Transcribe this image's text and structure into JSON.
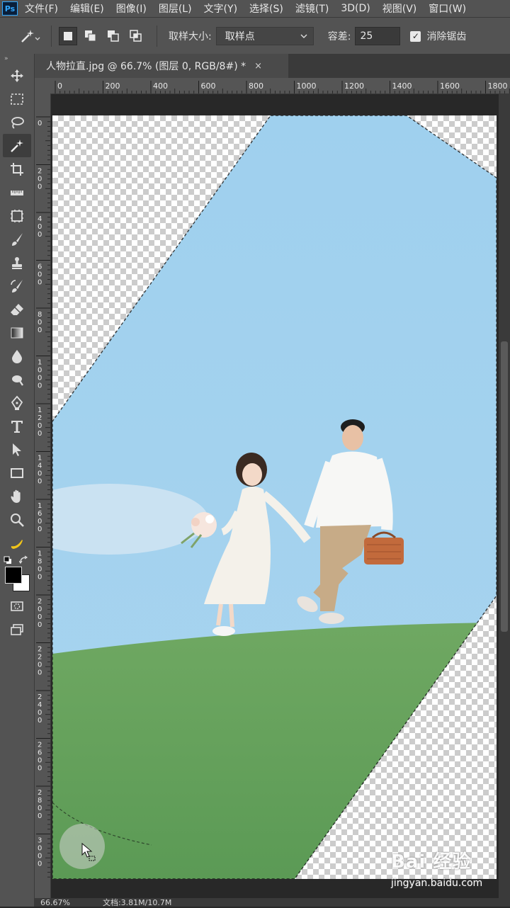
{
  "app": {
    "logo_text": "Ps"
  },
  "menu": [
    "文件(F)",
    "编辑(E)",
    "图像(I)",
    "图层(L)",
    "文字(Y)",
    "选择(S)",
    "滤镜(T)",
    "3D(D)",
    "视图(V)",
    "窗口(W)"
  ],
  "options": {
    "sample_size_label": "取样大小:",
    "sample_size_value": "取样点",
    "tolerance_label": "容差:",
    "tolerance_value": "25",
    "antialias_label": "消除锯齿",
    "antialias_checked": true
  },
  "document": {
    "tab_title": "人物拉直.jpg @ 66.7% (图层 0, RGB/8#) *",
    "close_symbol": "×"
  },
  "ruler": {
    "h_ticks": [
      "0",
      "200",
      "400",
      "600",
      "800",
      "1000",
      "1200",
      "1400",
      "1600",
      "1800"
    ],
    "v_ticks": [
      "0",
      "200",
      "400",
      "600",
      "800",
      "1000",
      "1200",
      "1400",
      "1600",
      "1800",
      "2000",
      "2200",
      "2400",
      "2600",
      "2800",
      "3000"
    ]
  },
  "tools": [
    "move-icon",
    "marquee-icon",
    "lasso-icon",
    "magic-wand-icon",
    "crop-icon",
    "ruler-icon",
    "frame-icon",
    "brush-icon",
    "stamp-icon",
    "history-brush-icon",
    "eraser-icon",
    "gradient-icon",
    "blur-icon",
    "dodge-icon",
    "pen-icon",
    "type-icon",
    "path-select-icon",
    "rectangle-icon",
    "hand-icon",
    "zoom-icon",
    "banana-icon"
  ],
  "colors": {
    "foreground": "#000000",
    "background": "#ffffff"
  },
  "status": {
    "zoom": "66.67%",
    "doc_size": "文档:3.81M/10.7M"
  },
  "watermark": {
    "logo": "Bai 经验",
    "url": "jingyan.baidu.com"
  }
}
